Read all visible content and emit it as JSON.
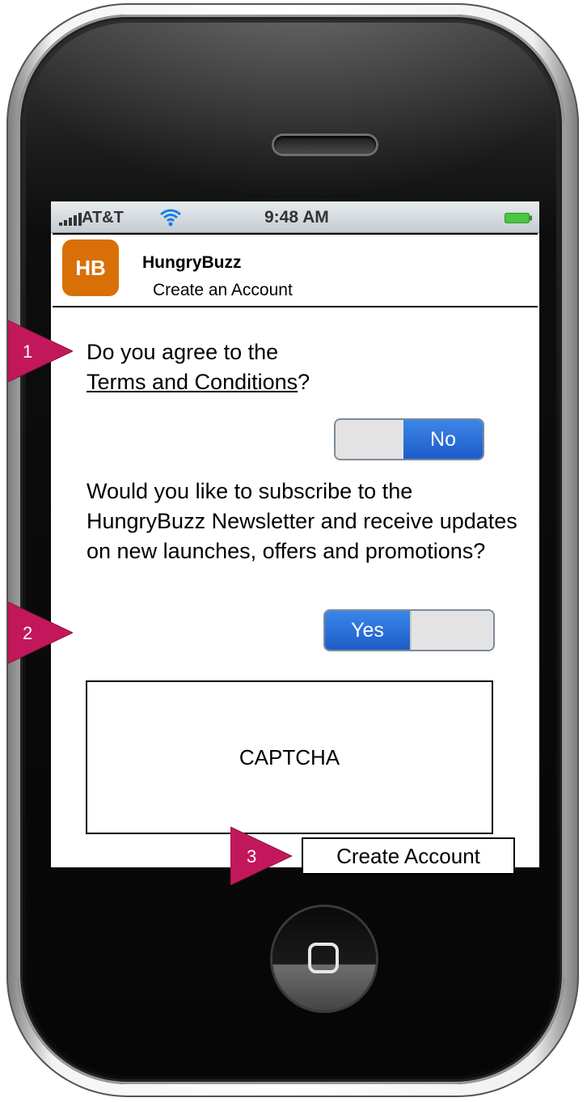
{
  "status_bar": {
    "carrier": "AT&T",
    "time": "9:48 AM",
    "icons": [
      "signal-icon",
      "wifi-icon",
      "battery-icon"
    ]
  },
  "header": {
    "logo_text": "HB",
    "app_name": "HungryBuzz",
    "subtitle": "Create an Account"
  },
  "terms": {
    "prefix": "Do you agree to the",
    "link": "Terms and Conditions",
    "suffix": "?",
    "toggle_label": "No"
  },
  "newsletter": {
    "question": "Would you like to subscribe to the HungryBuzz Newsletter and receive updates on new launches, offers and promotions?",
    "toggle_label": "Yes"
  },
  "captcha": {
    "label": "CAPTCHA"
  },
  "actions": {
    "create_account": "Create Account"
  },
  "annotations": [
    "1",
    "2",
    "3"
  ],
  "colors": {
    "logo": "#d96f07",
    "toggle_on": "#2a6fd8",
    "marker": "#c2185b"
  }
}
